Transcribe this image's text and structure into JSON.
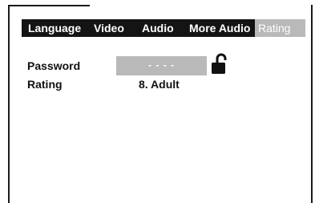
{
  "tabs": [
    {
      "label": "Language"
    },
    {
      "label": "Video"
    },
    {
      "label": "Audio"
    },
    {
      "label": "More Audio"
    },
    {
      "label": "Rating"
    }
  ],
  "selected_tab": "Rating",
  "password": {
    "label": "Password",
    "value": "- - - -",
    "lock_icon": "unlocked-padlock-icon"
  },
  "rating": {
    "label": "Rating",
    "value": "8. Adult"
  },
  "colors": {
    "tab_bar": "#141414",
    "selected_tab": "#b9b9b9",
    "field": "#b9b9b9"
  }
}
